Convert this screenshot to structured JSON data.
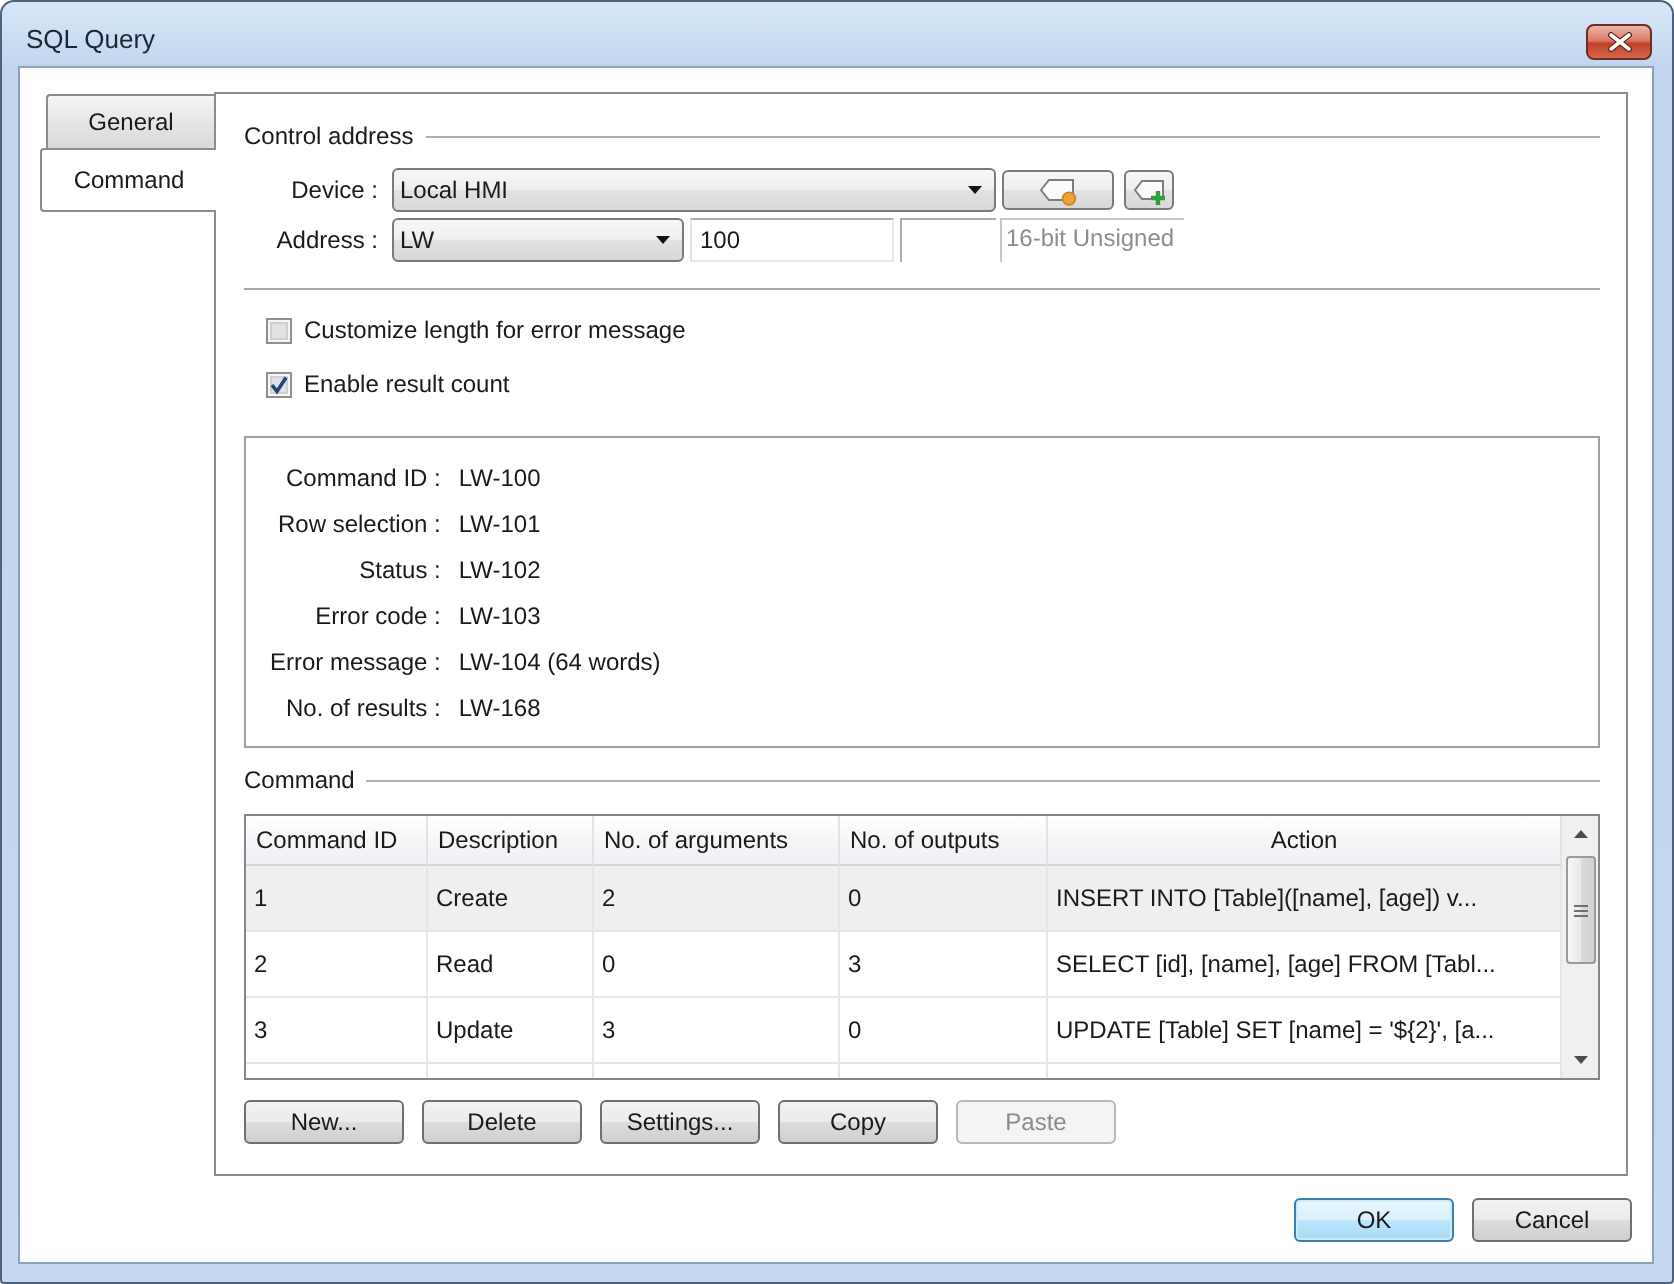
{
  "window": {
    "title": "SQL Query"
  },
  "tabs": [
    {
      "label": "General",
      "selected": false
    },
    {
      "label": "Command",
      "selected": true
    }
  ],
  "control_address": {
    "title": "Control address",
    "device": {
      "label": "Device :",
      "value": "Local HMI"
    },
    "address": {
      "label": "Address :",
      "type": "LW",
      "value": "100",
      "format": "16-bit Unsigned"
    }
  },
  "options": [
    {
      "label": "Customize length for error message",
      "checked": false
    },
    {
      "label": "Enable result count",
      "checked": true
    }
  ],
  "addresses": [
    {
      "label": "Command ID :",
      "value": "LW-100"
    },
    {
      "label": "Row selection :",
      "value": "LW-101"
    },
    {
      "label": "Status :",
      "value": "LW-102"
    },
    {
      "label": "Error code :",
      "value": "LW-103"
    },
    {
      "label": "Error message :",
      "value": "LW-104 (64 words)"
    },
    {
      "label": "No. of results :",
      "value": "LW-168"
    }
  ],
  "command": {
    "title": "Command",
    "table": {
      "columns": [
        "Command ID",
        "Description",
        "No. of arguments",
        "No. of outputs",
        "Action"
      ],
      "rows": [
        {
          "cells": [
            "1",
            "Create",
            "2",
            "0",
            "INSERT INTO [Table]([name], [age]) v..."
          ],
          "selected": true
        },
        {
          "cells": [
            "2",
            "Read",
            "0",
            "3",
            "SELECT [id], [name], [age] FROM [Tabl..."
          ],
          "selected": false
        },
        {
          "cells": [
            "3",
            "Update",
            "3",
            "0",
            "UPDATE [Table] SET [name] = '${2}', [a..."
          ],
          "selected": false
        }
      ]
    },
    "buttons": [
      {
        "label": "New...",
        "disabled": false
      },
      {
        "label": "Delete",
        "disabled": false
      },
      {
        "label": "Settings...",
        "disabled": false
      },
      {
        "label": "Copy",
        "disabled": false
      },
      {
        "label": "Paste",
        "disabled": true
      }
    ]
  },
  "buttons": [
    {
      "label": "OK",
      "focused": true
    },
    {
      "label": "Cancel",
      "focused": false
    }
  ]
}
